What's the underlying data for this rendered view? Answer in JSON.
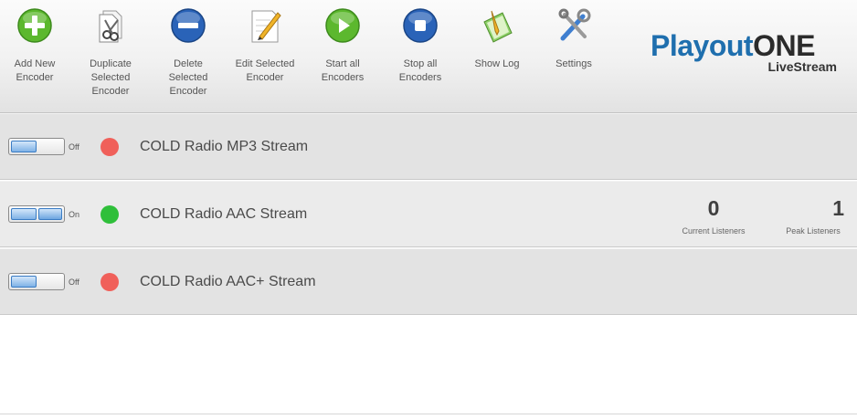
{
  "toolbar": {
    "buttons": [
      {
        "label": "Add New\nEncoder",
        "icon": "add-icon"
      },
      {
        "label": "Duplicate\nSelected\nEncoder",
        "icon": "duplicate-icon"
      },
      {
        "label": "Delete\nSelected\nEncoder",
        "icon": "delete-icon"
      },
      {
        "label": "Edit Selected\nEncoder",
        "icon": "edit-icon"
      },
      {
        "label": "Start all\nEncoders",
        "icon": "play-icon"
      },
      {
        "label": "Stop all\nEncoders",
        "icon": "stop-icon"
      },
      {
        "label": "Show Log",
        "icon": "log-icon"
      },
      {
        "label": "Settings",
        "icon": "settings-icon"
      }
    ]
  },
  "logo": {
    "part1": "Playout",
    "part2": "ONE",
    "sub": "LiveStream"
  },
  "encoders": [
    {
      "name": "COLD Radio MP3 Stream",
      "state": "Off",
      "status_color": "#f0605a"
    },
    {
      "name": "COLD Radio AAC Stream",
      "state": "On",
      "status_color": "#2fbf3a",
      "current_listeners": "0",
      "current_label": "Current Listeners",
      "peak_listeners": "1",
      "peak_label": "Peak Listeners"
    },
    {
      "name": "COLD Radio AAC+ Stream",
      "state": "Off",
      "status_color": "#f0605a"
    }
  ],
  "colors": {
    "accent_blue": "#1f6fae",
    "on": "#2fbf3a",
    "off": "#f0605a"
  }
}
